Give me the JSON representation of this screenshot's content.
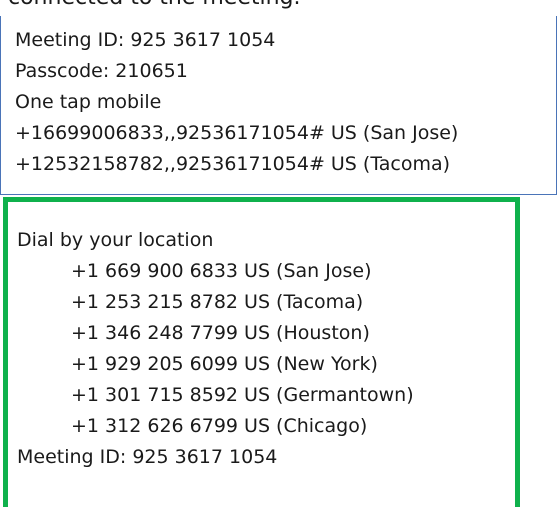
{
  "heading_fragment": "connected to the meeting.",
  "top_box": {
    "lines": [
      "Meeting ID: 925 3617 1054",
      "Passcode: 210651",
      "One tap mobile",
      "+16699006833,,92536171054# US (San Jose)",
      "+12532158782,,92536171054# US (Tacoma)"
    ]
  },
  "dial_box": {
    "title": "Dial by your location",
    "numbers": [
      "+1 669 900 6833 US (San Jose)",
      "+1 253 215 8782 US (Tacoma)",
      "+1 346 248 7799 US (Houston)",
      "+1 929 205 6099 US (New York)",
      "+1 301 715 8592 US (Germantown)",
      "+1 312 626 6799 US (Chicago)"
    ],
    "footer": "Meeting ID: 925 3617 1054"
  },
  "colors": {
    "top_border": "#4a74b8",
    "highlight_border": "#0fb14c",
    "text": "#1a1a1a"
  }
}
